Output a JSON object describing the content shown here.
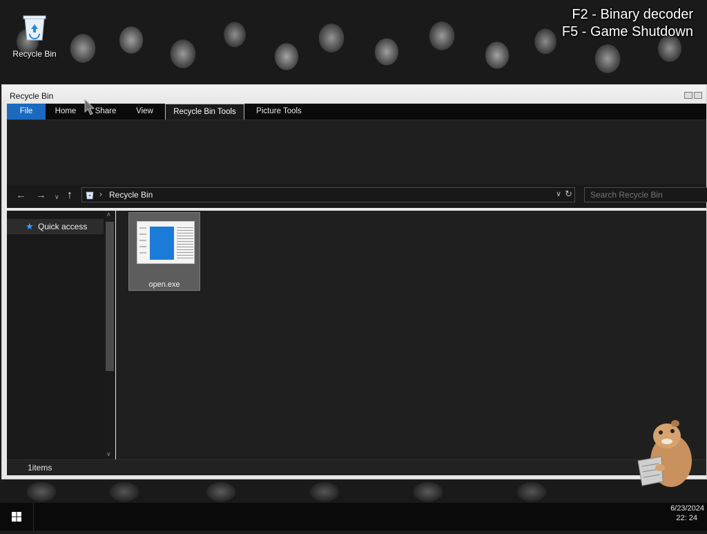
{
  "overlay": {
    "hint_binary": "F2 - Binary decoder",
    "hint_shutdown": "F5 - Game Shutdown"
  },
  "desktop": {
    "recycle_bin_label": "Recycle Bin"
  },
  "window": {
    "title": "Recycle Bin",
    "tabs": {
      "file": "File",
      "home": "Home",
      "share": "Share",
      "view": "View",
      "recycle_bin_tools": "Recycle Bin Tools",
      "picture_tools": "Picture Tools"
    },
    "address": {
      "path": "Recycle Bin",
      "search_placeholder": "Search Recycle Bin"
    },
    "navpane": {
      "quick_access": "Quick access"
    },
    "files": [
      {
        "name": "open.exe"
      }
    ],
    "status": "1items"
  },
  "taskbar": {
    "date": "6/23/2024",
    "time": "22: 24"
  },
  "colors": {
    "file_tab": "#1b6ac0",
    "quick_access_star": "#3aa0ff",
    "thumbnail_document": "#1b7bd8"
  },
  "icons": {
    "back": "arrow-left-icon",
    "forward": "arrow-right-icon",
    "recent": "chevron-down-icon",
    "up": "arrow-up-icon",
    "refresh": "refresh-icon",
    "quick_access": "star-icon",
    "start": "windows-logo-icon"
  }
}
